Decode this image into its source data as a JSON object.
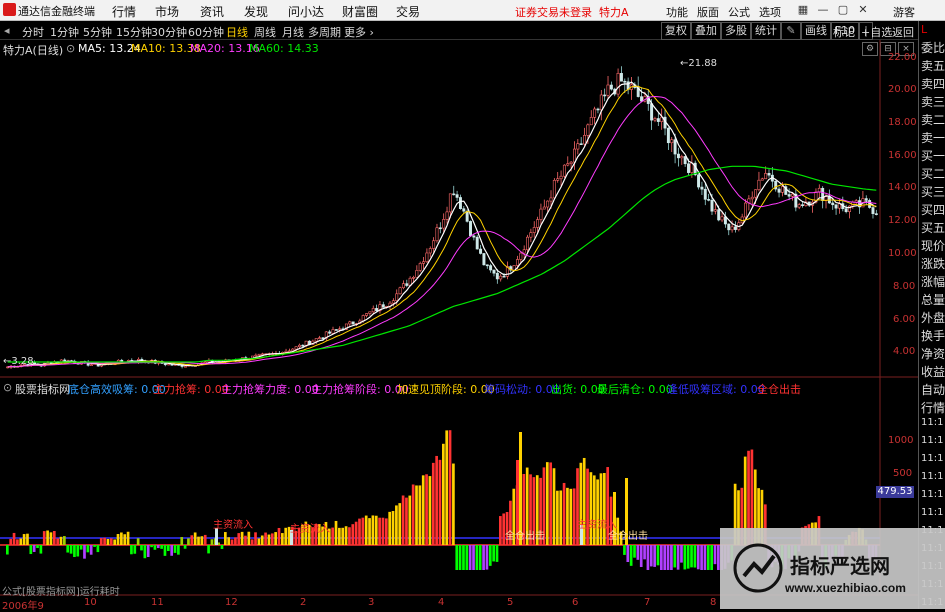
{
  "titlebar": {
    "app_name": "通达信金融终端",
    "menus": [
      "行情",
      "市场",
      "资讯",
      "发现",
      "问小达",
      "财富圈",
      "交易"
    ],
    "login_status": "证券交易未登录",
    "stock_short": "特力A",
    "right_items": [
      "功能",
      "版面",
      "公式",
      "选项"
    ],
    "guest": "游客"
  },
  "toolbar": {
    "periods": [
      "分时",
      "1分钟",
      "5分钟",
      "15分钟",
      "30分钟",
      "60分钟",
      "日线",
      "周线",
      "月线",
      "多周期",
      "更多"
    ],
    "active_period": "日线",
    "right_buttons": [
      "复权",
      "叠加",
      "多股",
      "统计",
      "画线",
      "F10",
      "标记",
      "+自选",
      "返回"
    ]
  },
  "chart_header": {
    "stock": "特力A(日线)",
    "ma5": "MA5: 13.24",
    "ma10": "MA10: 13.38",
    "ma20": "MA20: 13.16",
    "ma60": "MA60: 14.33"
  },
  "colors": {
    "ma5": "#ffffff",
    "ma10": "#ffd200",
    "ma20": "#ff3cff",
    "ma60": "#00e600",
    "up": "#ff3232",
    "down": "#00ffff",
    "axis": "#c83232"
  },
  "indicator_header": {
    "name": "股票指标网",
    "items": [
      {
        "label": "底仓高效吸筹: 0.00",
        "color": "#32a0ff"
      },
      {
        "label": "主力抢筹: 0.00",
        "color": "#ff3232"
      },
      {
        "label": "主力抢筹力度: 0.00",
        "color": "#ff3cff"
      },
      {
        "label": "主力抢筹阶段: 0.00",
        "color": "#ff3cff"
      },
      {
        "label": "加速见顶阶段: 0.00",
        "color": "#ffd200"
      },
      {
        "label": "筹码松动: 0.00",
        "color": "#3232ff"
      },
      {
        "label": "出货: 0.00",
        "color": "#00ff00"
      },
      {
        "label": "最后清仓: 0.00",
        "color": "#00ff00"
      },
      {
        "label": "逢低吸筹区域: 0.00",
        "color": "#3232ff"
      },
      {
        "label": "全仓出击",
        "color": "#ff3232"
      }
    ]
  },
  "price_axis": [
    "22.00",
    "20.00",
    "18.00",
    "16.00",
    "14.00",
    "12.00",
    "10.00",
    "8.00",
    "6.00",
    "4.00"
  ],
  "indicator_axis": [
    "1000",
    "500"
  ],
  "indicator_value_badge": "479.53",
  "annotations": {
    "high": "21.88",
    "low": "3.28",
    "signal_main_inflow_1": "主资流入",
    "signal_main_inflow_2": "主资流入",
    "signal_main_inflow_3": "主资流入",
    "signal_full_1": "全仓出击",
    "signal_full_2": "全仓出击"
  },
  "date_axis": [
    "2006年9",
    "10",
    "11",
    "12",
    "2",
    "3",
    "4",
    "5",
    "6",
    "7",
    "8",
    "9",
    "10"
  ],
  "statusline": "公式[股票指标网]运行耗时",
  "sidebar": {
    "badge": "L",
    "items": [
      "委比",
      "卖五",
      "卖四",
      "卖三",
      "卖二",
      "卖一",
      "买一",
      "买二",
      "买三",
      "买四",
      "买五",
      "现价",
      "涨跌",
      "涨幅",
      "总量",
      "外盘",
      "换手",
      "净资",
      "收益",
      "自动",
      "行情",
      "11:1",
      "11:1",
      "11:1",
      "11:1",
      "11:1",
      "11:1",
      "11:1",
      "11:1",
      "11:1",
      "11:1",
      "11:1"
    ]
  },
  "watermark": {
    "title": "指标严选网",
    "url": "www.xuezhibiao.com"
  },
  "chart_data": {
    "type": "candlestick",
    "ylim": [
      3,
      23
    ],
    "close_series": [
      3.5,
      3.6,
      3.7,
      3.6,
      3.8,
      3.9,
      3.8,
      3.7,
      3.6,
      3.7,
      3.8,
      3.9,
      3.9,
      3.8,
      3.7,
      3.6,
      3.6,
      3.7,
      3.8,
      3.8,
      3.9,
      4.0,
      4.1,
      4.2,
      4.3,
      4.5,
      4.7,
      5.0,
      5.3,
      5.6,
      5.9,
      6.2,
      6.6,
      7.0,
      7.4,
      8.0,
      8.8,
      9.8,
      11.0,
      12.5,
      14.5,
      13.0,
      11.0,
      9.5,
      9.0,
      9.5,
      10.5,
      11.8,
      13.0,
      14.5,
      15.5,
      16.5,
      18.0,
      19.2,
      20.5,
      21.0,
      20.5,
      19.8,
      19.0,
      18.0,
      16.8,
      16.0,
      15.0,
      13.5,
      12.5,
      11.8,
      12.8,
      14.5,
      15.5,
      14.8,
      14.0,
      13.5,
      13.8,
      14.2,
      13.6,
      13.2,
      13.3,
      13.5,
      13.1
    ],
    "ma60_series": [
      3.8,
      3.8,
      3.8,
      3.8,
      3.8,
      3.8,
      3.8,
      3.8,
      3.8,
      3.8,
      3.8,
      3.8,
      3.8,
      3.8,
      3.8,
      3.8,
      3.8,
      3.8,
      3.9,
      3.9,
      3.9,
      4.0,
      4.0,
      4.1,
      4.2,
      4.3,
      4.4,
      4.5,
      4.6,
      4.7,
      4.8,
      5.0,
      5.2,
      5.4,
      5.6,
      5.8,
      6.0,
      6.3,
      6.6,
      6.9,
      7.2,
      7.4,
      7.6,
      7.8,
      8.0,
      8.3,
      8.6,
      8.9,
      9.2,
      9.6,
      10.0,
      10.5,
      11.0,
      11.5,
      12.0,
      12.6,
      13.2,
      13.8,
      14.3,
      14.7,
      15.0,
      15.2,
      15.4,
      15.6,
      15.7,
      15.8,
      15.8,
      15.8,
      15.7,
      15.6,
      15.5,
      15.3,
      15.1,
      14.9,
      14.7,
      14.6,
      14.5,
      14.4,
      14.33
    ],
    "indicator_ylim": [
      0,
      1200
    ]
  }
}
